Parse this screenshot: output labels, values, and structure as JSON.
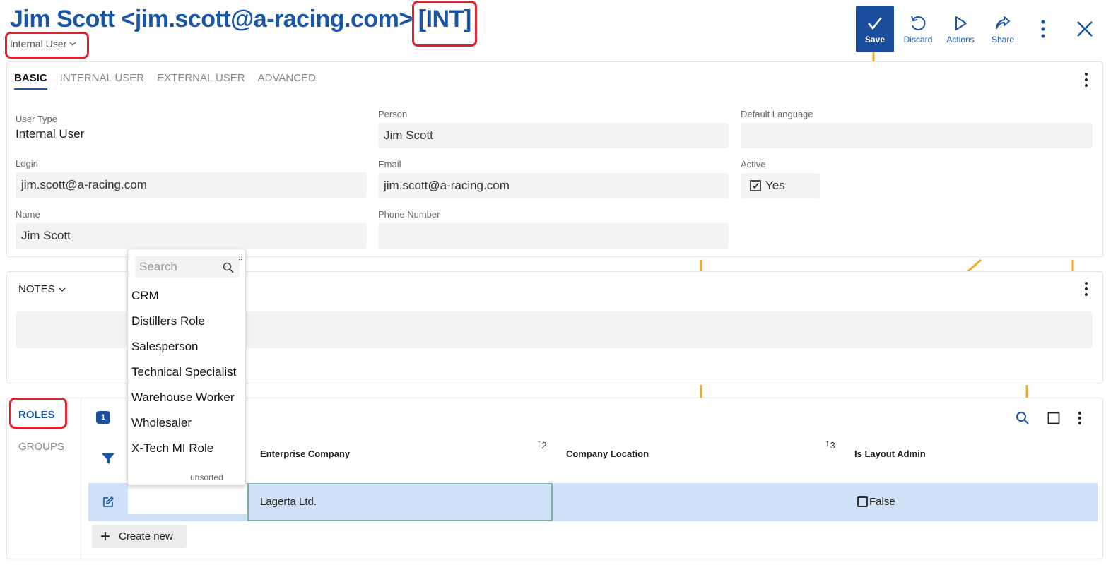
{
  "header": {
    "title": "Jim Scott <jim.scott@a-racing.com>",
    "title_tag": "[INT]",
    "user_type_toggle": "Internal User"
  },
  "toolbar": {
    "save": "Save",
    "discard": "Discard",
    "actions": "Actions",
    "share": "Share"
  },
  "tabs": [
    "BASIC",
    "INTERNAL USER",
    "EXTERNAL USER",
    "ADVANCED"
  ],
  "basic": {
    "user_type": {
      "label": "User Type",
      "value": "Internal User"
    },
    "person": {
      "label": "Person",
      "value": "Jim Scott"
    },
    "default_language": {
      "label": "Default Language",
      "value": ""
    },
    "login": {
      "label": "Login",
      "value": "jim.scott@a-racing.com"
    },
    "email": {
      "label": "Email",
      "value": "jim.scott@a-racing.com"
    },
    "active": {
      "label": "Active",
      "value": "Yes"
    },
    "name": {
      "label": "Name",
      "value": "Jim Scott"
    },
    "phone": {
      "label": "Phone Number",
      "value": ""
    }
  },
  "notes": {
    "label": "NOTES"
  },
  "roles": {
    "side_tabs": [
      "ROLES",
      "GROUPS"
    ],
    "count": "1",
    "columns": {
      "enterprise_company": "Enterprise Company",
      "company_location": "Company Location",
      "is_layout_admin": "Is Layout Admin"
    },
    "sort_indices": [
      "2",
      "3"
    ],
    "row": {
      "role": "",
      "enterprise_company": "Lagerta Ltd.",
      "company_location": "",
      "is_layout_admin": "False"
    },
    "create_new": "Create new"
  },
  "dropdown": {
    "search_placeholder": "Search",
    "items": [
      "CRM",
      "Distillers Role",
      "Salesperson",
      "Technical Specialist",
      "Warehouse Worker",
      "Wholesaler",
      "X-Tech MI Role"
    ],
    "footer": "unsorted"
  },
  "colors": {
    "accent": "#1a56a6",
    "save_bg": "#1a4d9c",
    "highlight": "#e0202a",
    "row_selected": "#cfe0f7",
    "background_lines": "#f5a623"
  }
}
